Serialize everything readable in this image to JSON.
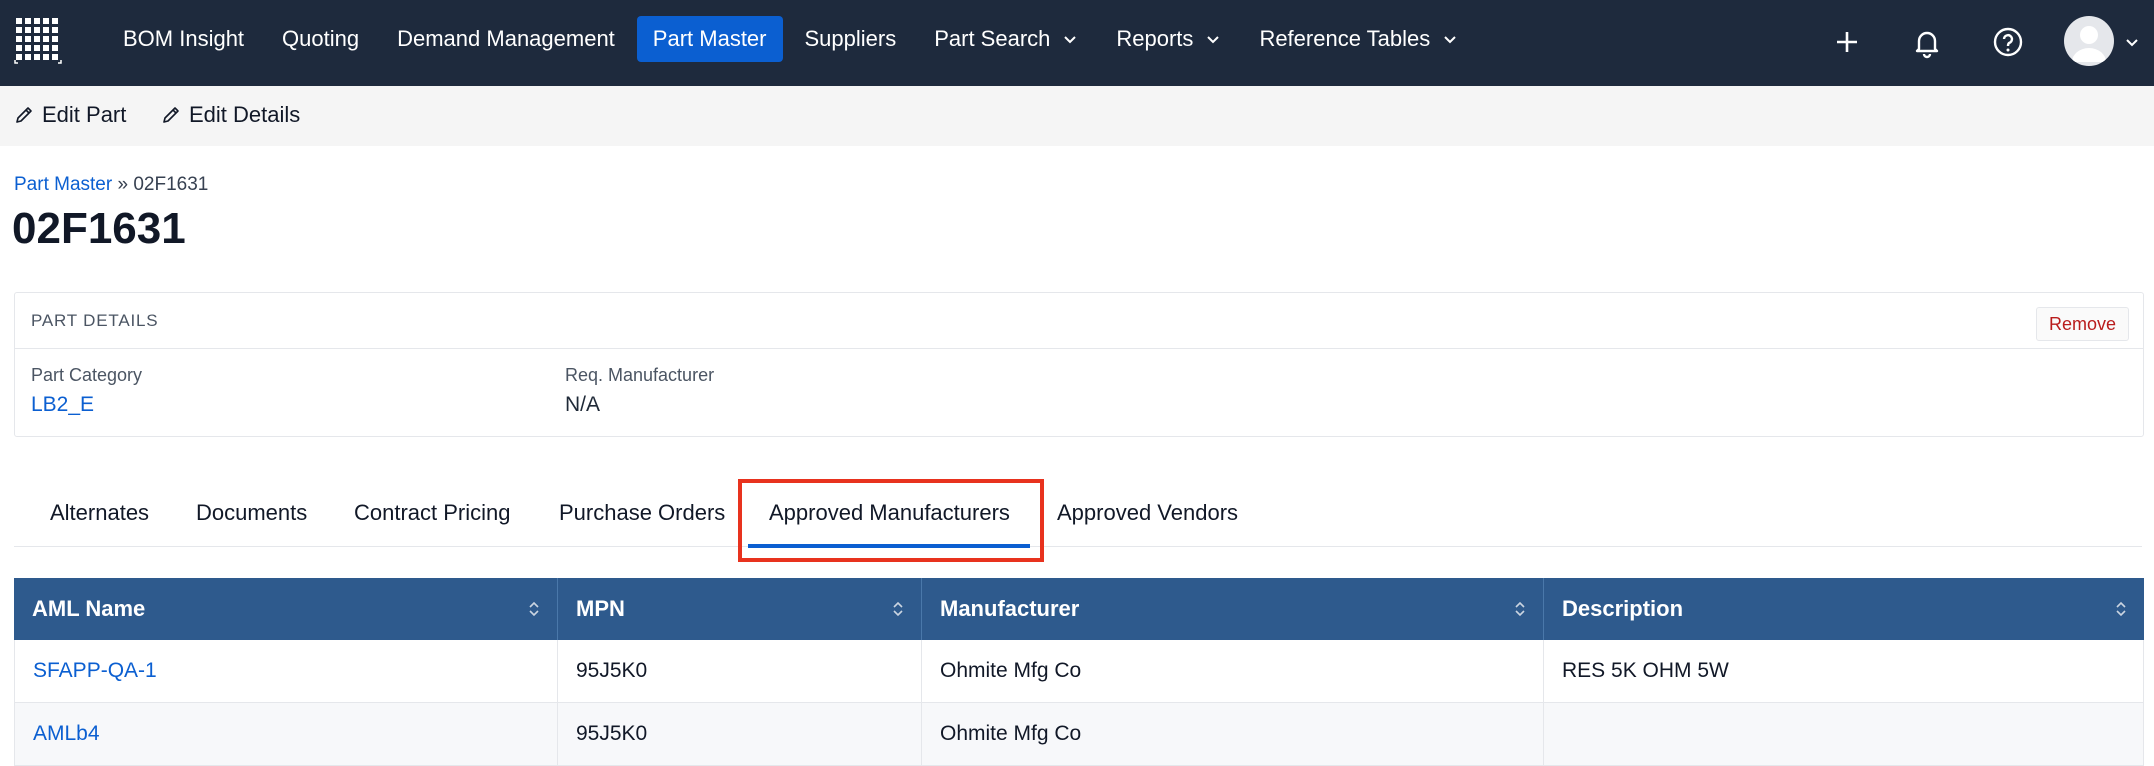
{
  "nav": {
    "items": [
      {
        "label": "BOM Insight",
        "active": false,
        "dropdown": false
      },
      {
        "label": "Quoting",
        "active": false,
        "dropdown": false
      },
      {
        "label": "Demand Management",
        "active": false,
        "dropdown": false
      },
      {
        "label": "Part Master",
        "active": true,
        "dropdown": false
      },
      {
        "label": "Suppliers",
        "active": false,
        "dropdown": false
      },
      {
        "label": "Part Search",
        "active": false,
        "dropdown": true
      },
      {
        "label": "Reports",
        "active": false,
        "dropdown": true
      },
      {
        "label": "Reference Tables",
        "active": false,
        "dropdown": true
      }
    ],
    "icons": [
      "plus-icon",
      "bell-icon",
      "help-icon",
      "avatar"
    ]
  },
  "toolbar": {
    "edit_part_label": "Edit Part",
    "edit_details_label": "Edit Details"
  },
  "breadcrumb": {
    "parent": "Part Master",
    "separator": "»",
    "current": "02F1631"
  },
  "page_title": "02F1631",
  "part_details": {
    "title": "PART DETAILS",
    "remove_label": "Remove",
    "fields": [
      {
        "label": "Part Category",
        "value": "LB2_E"
      },
      {
        "label": "Req. Manufacturer",
        "value": "N/A"
      }
    ]
  },
  "tabs": [
    {
      "label": "Alternates"
    },
    {
      "label": "Documents"
    },
    {
      "label": "Contract Pricing"
    },
    {
      "label": "Purchase Orders"
    },
    {
      "label": "Approved Manufacturers",
      "active": true
    },
    {
      "label": "Approved Vendors"
    }
  ],
  "table": {
    "columns": [
      "AML Name",
      "MPN",
      "Manufacturer",
      "Description"
    ],
    "rows": [
      [
        "SFAPP-QA-1",
        "95J5K0",
        "Ohmite Mfg Co",
        "RES 5K OHM 5W"
      ],
      [
        "AMLb4",
        "95J5K0",
        "Ohmite Mfg Co",
        ""
      ]
    ]
  },
  "colors": {
    "nav_bg": "#1e2a3d",
    "accent": "#0b5fd1",
    "table_header": "#2e5a8d",
    "highlight": "#e8321e",
    "remove_text": "#b91c1c"
  }
}
